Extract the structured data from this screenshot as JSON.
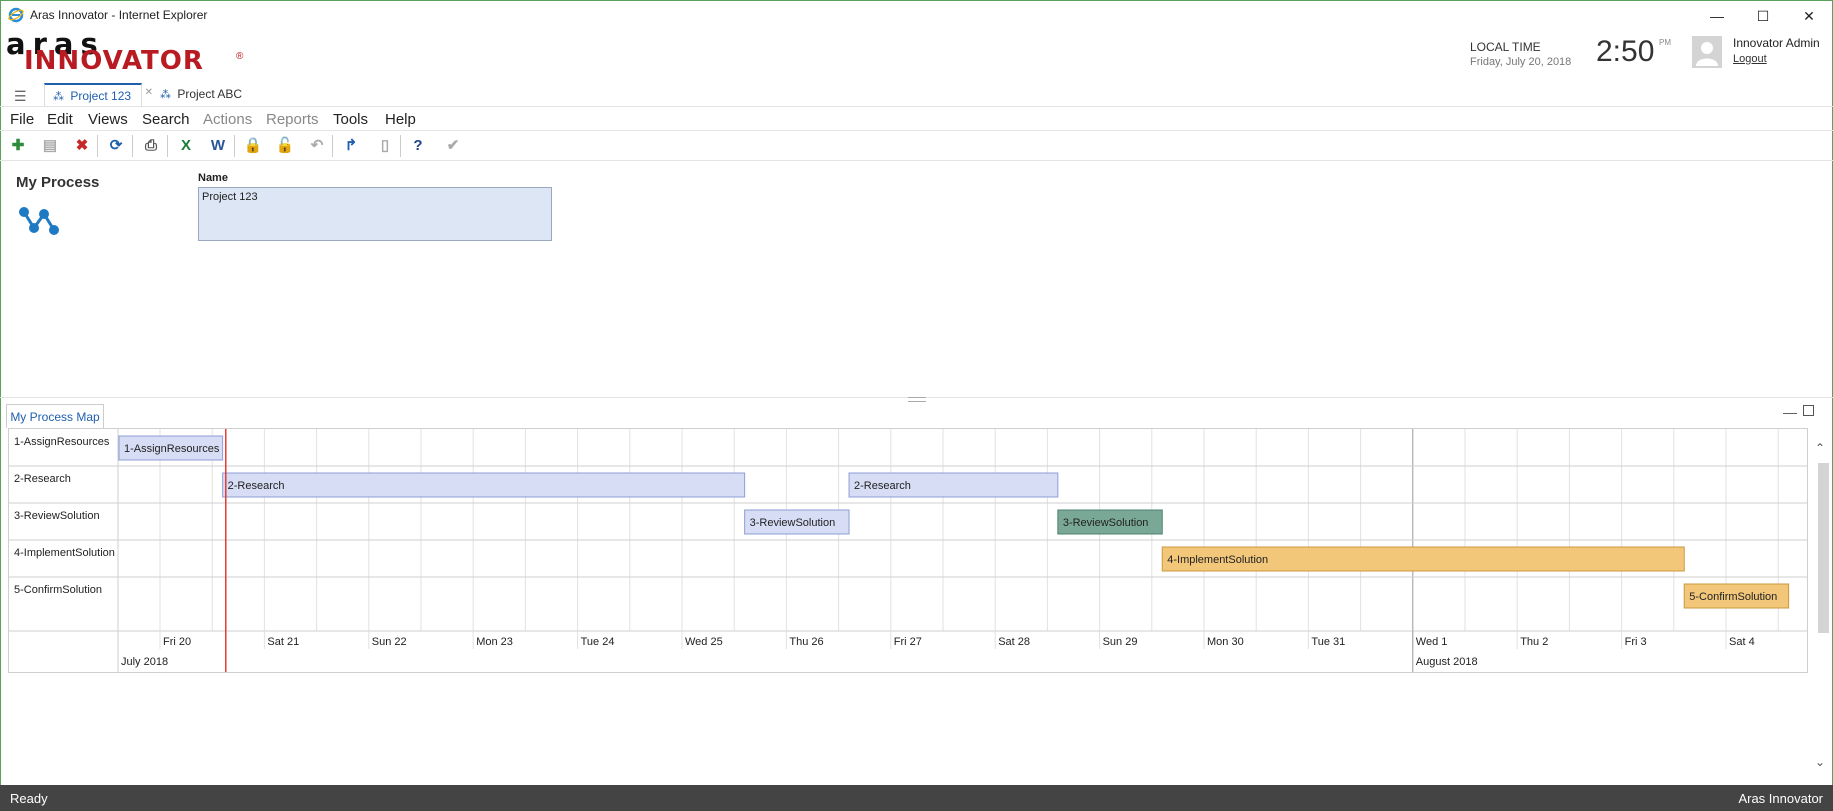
{
  "window": {
    "title": "Aras Innovator - Internet Explorer",
    "minimize": "—",
    "maximize": "☐",
    "close": "✕"
  },
  "logo": {
    "aras": "aras",
    "innovator": "INNOVATOR",
    "reg": "®"
  },
  "header": {
    "local_time_label": "LOCAL TIME",
    "date": "Friday, July 20, 2018",
    "time": "2:50",
    "ampm": "PM",
    "user_name": "Innovator Admin",
    "logout": "Logout"
  },
  "tabs": [
    {
      "label": "Project 123",
      "active": true
    },
    {
      "label": "Project ABC",
      "active": false
    }
  ],
  "menu": [
    {
      "label": "File",
      "enabled": true
    },
    {
      "label": "Edit",
      "enabled": true
    },
    {
      "label": "Views",
      "enabled": true
    },
    {
      "label": "Search",
      "enabled": true
    },
    {
      "label": "Actions",
      "enabled": false
    },
    {
      "label": "Reports",
      "enabled": false
    },
    {
      "label": "Tools",
      "enabled": true
    },
    {
      "label": "Help",
      "enabled": true
    }
  ],
  "toolbar": [
    {
      "icon": "new-item-icon",
      "enabled": true,
      "glyph": "✚",
      "color": "#2e8b3a"
    },
    {
      "icon": "save-icon",
      "enabled": false,
      "glyph": "▤",
      "color": "#aaaaaa"
    },
    {
      "icon": "delete-icon",
      "enabled": true,
      "glyph": "✖",
      "color": "#c62828"
    },
    {
      "icon": "refresh-icon",
      "enabled": true,
      "glyph": "⟳",
      "color": "#1f5fad"
    },
    {
      "icon": "print-icon",
      "enabled": true,
      "glyph": "⎙",
      "color": "#555555"
    },
    {
      "icon": "excel-icon",
      "enabled": true,
      "glyph": "X",
      "color": "#1d7a3a"
    },
    {
      "icon": "word-icon",
      "enabled": true,
      "glyph": "W",
      "color": "#2b5797"
    },
    {
      "icon": "lock-icon",
      "enabled": true,
      "glyph": "🔒",
      "color": "#1f5fad"
    },
    {
      "icon": "unlock-icon",
      "enabled": false,
      "glyph": "🔓",
      "color": "#aaaaaa"
    },
    {
      "icon": "undo-icon",
      "enabled": false,
      "glyph": "↶",
      "color": "#aaaaaa"
    },
    {
      "icon": "promote-icon",
      "enabled": true,
      "glyph": "↱",
      "color": "#1f5fad"
    },
    {
      "icon": "clipboard-icon",
      "enabled": false,
      "glyph": "▯",
      "color": "#aaaaaa"
    },
    {
      "icon": "help-icon",
      "enabled": true,
      "glyph": "?",
      "color": "#1f3f8f"
    },
    {
      "icon": "check-icon",
      "enabled": false,
      "glyph": "✔",
      "color": "#aaaaaa"
    }
  ],
  "form": {
    "title": "My Process",
    "name_label": "Name",
    "name_value": "Project 123"
  },
  "map_panel": {
    "tab_label": "My Process Map",
    "rows": [
      "1-AssignResources",
      "2-Research",
      "3-ReviewSolution",
      "4-ImplementSolution",
      "5-ConfirmSolution"
    ],
    "days": [
      "Fri 20",
      "Sat 21",
      "Sun 22",
      "Mon 23",
      "Tue 24",
      "Wed 25",
      "Thu 26",
      "Fri 27",
      "Sat 28",
      "Sun 29",
      "Mon 30",
      "Tue 31",
      "Wed 1",
      "Thu 2",
      "Fri 3",
      "Sat 4"
    ],
    "months": [
      {
        "label": "July 2018",
        "start_day_index": 0
      },
      {
        "label": "August 2018",
        "start_day_index": 12
      }
    ],
    "today_offset_days": 0.63,
    "bars": [
      {
        "row": 0,
        "label": "1-AssignResources",
        "start": -0.4,
        "duration": 1.0,
        "color": "#d6ddf5",
        "border": "#8f9dd6"
      },
      {
        "row": 1,
        "label": "2-Research",
        "start": 0.6,
        "duration": 5.0,
        "color": "#d6ddf5",
        "border": "#8f9dd6"
      },
      {
        "row": 1,
        "label": "2-Research",
        "start": 6.6,
        "duration": 2.0,
        "color": "#d6ddf5",
        "border": "#8f9dd6"
      },
      {
        "row": 2,
        "label": "3-ReviewSolution",
        "start": 5.6,
        "duration": 1.0,
        "color": "#d6ddf5",
        "border": "#8f9dd6"
      },
      {
        "row": 2,
        "label": "3-ReviewSolution",
        "start": 8.6,
        "duration": 1.0,
        "color": "#7aa897",
        "border": "#4e8070"
      },
      {
        "row": 3,
        "label": "4-ImplementSolution",
        "start": 9.6,
        "duration": 5.0,
        "color": "#f2c77a",
        "border": "#c99a3e"
      },
      {
        "row": 4,
        "label": "5-ConfirmSolution",
        "start": 14.6,
        "duration": 1.0,
        "color": "#f2c77a",
        "border": "#c99a3e"
      }
    ]
  },
  "status": {
    "left": "Ready",
    "right": "Aras Innovator"
  }
}
